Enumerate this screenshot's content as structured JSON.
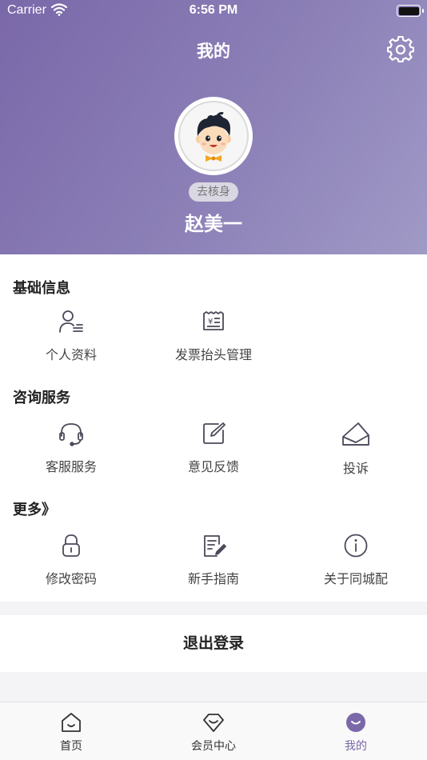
{
  "status_bar": {
    "carrier": "Carrier",
    "time": "6:56 PM"
  },
  "header": {
    "title": "我的",
    "settings_icon": "gear-icon",
    "verify_label": "去核身",
    "user_name": "赵美一"
  },
  "sections": {
    "basic": {
      "title": "基础信息",
      "items": [
        {
          "label": "个人资料",
          "icon": "person-icon"
        },
        {
          "label": "发票抬头管理",
          "icon": "invoice-icon"
        }
      ]
    },
    "consult": {
      "title": "咨询服务",
      "items": [
        {
          "label": "客服服务",
          "icon": "headset-icon"
        },
        {
          "label": "意见反馈",
          "icon": "edit-icon"
        },
        {
          "label": "投诉",
          "icon": "envelope-icon"
        }
      ]
    },
    "more": {
      "title": "更多》",
      "items": [
        {
          "label": "修改密码",
          "icon": "lock-icon"
        },
        {
          "label": "新手指南",
          "icon": "guide-icon"
        },
        {
          "label": "关于同城配",
          "icon": "info-icon"
        }
      ]
    }
  },
  "logout": {
    "label": "退出登录"
  },
  "tabs": [
    {
      "label": "首页",
      "icon": "home-icon"
    },
    {
      "label": "会员中心",
      "icon": "diamond-icon"
    },
    {
      "label": "我的",
      "icon": "profile-smile-icon",
      "active": true
    }
  ],
  "colors": {
    "accent": "#7a68a9",
    "header_gradient_start": "#7a68a9",
    "header_gradient_end": "#a09ac6",
    "icon_stroke": "#4a4a5a"
  }
}
